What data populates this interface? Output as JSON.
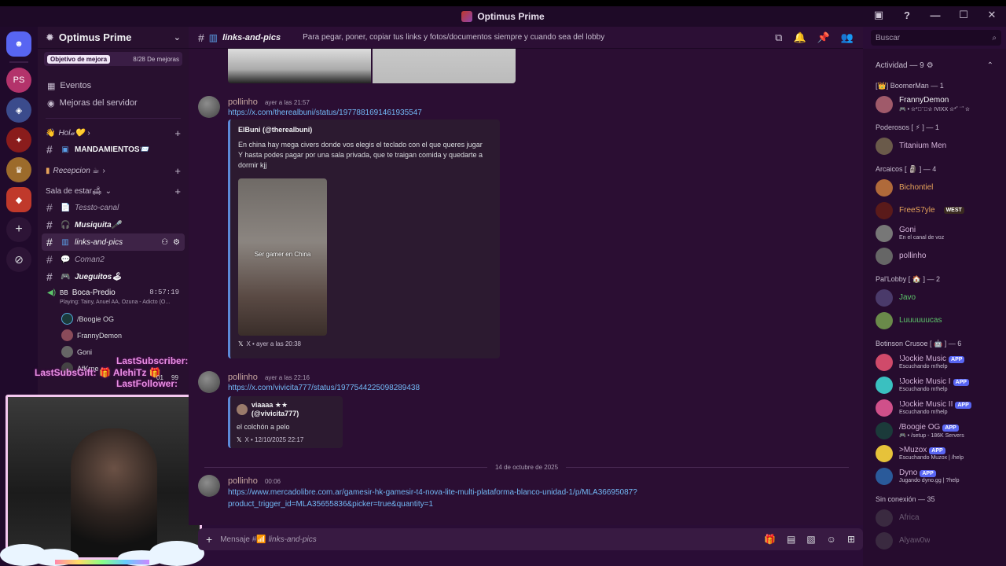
{
  "window": {
    "title": "Optimus Prime",
    "controls": [
      "▣",
      "?",
      "—",
      "☐",
      "✕"
    ]
  },
  "rail": {
    "servers": [
      "PS"
    ]
  },
  "sidebar": {
    "server_name": "Optimus Prime",
    "boost_goal": "Objetivo de mejora",
    "boost_count": "8/28 De mejoras",
    "links": [
      {
        "icon": "calendar-icon",
        "label": "Eventos"
      },
      {
        "icon": "shield-icon",
        "label": "Mejoras del servidor"
      }
    ],
    "categories": {
      "hola": "Hol𝒶💛",
      "recepcion": "Recepcion ☕",
      "sala": "Sala de estar🛋"
    },
    "channels": {
      "mandamientos": "MANDAMIENTOS📨",
      "testo": "Tessto-canal",
      "musiquita": "Musiquita🎤",
      "links": "links-and-pics",
      "coman2": "Coman2",
      "jueguitos": "Jueguitos🕹"
    },
    "voice": {
      "channel": "Boca-Predio",
      "timer": "8:57:19",
      "bb": "BB",
      "playing": "Playing: Tainy, Anuel AA, Ozuna - Adicto (O...",
      "users": [
        "/Boogie OG",
        "FrannyDemon",
        "Goni",
        "AfKrne"
      ]
    }
  },
  "stream_overlay": {
    "last_subscriber": "LastSubscriber:",
    "last_subs_gift": "LastSubsGift: 🎁 AlehiTz 🎁",
    "last_follower": "LastFollower:",
    "counter_a": "01",
    "counter_b": "99"
  },
  "channel_header": {
    "name": "links-and-pics",
    "topic": "Para pegar, poner, copiar tus links y fotos/documentos siempre y cuando sea del lobby"
  },
  "search": {
    "placeholder": "Buscar"
  },
  "messages": [
    {
      "author": "pollinho",
      "time": "ayer a las 21:57",
      "link": "https://x.com/therealbuni/status/1977881691461935547",
      "embed_author": "ElBuni (@therealbuni)",
      "embed_text": [
        "En china hay mega civers donde vos elegis el teclado con el que queres jugar",
        "Y hasta podes pagar por una sala privada, que te traigan comida y quedarte a",
        "dormir kjj"
      ],
      "image_caption": "Ser gamer en China",
      "embed_footer": "X • ayer a las 20:38"
    },
    {
      "author": "pollinho",
      "time": "ayer a las 22:16",
      "link": "https://x.com/vivicita777/status/1977544225098289438",
      "embed_author": "viaaaa ★★ (@vivicita777)",
      "embed_text": [
        "el colchón a pelo"
      ],
      "embed_footer": "X • 12/10/2025 22:17"
    },
    {
      "author": "pollinho",
      "time": "00:06",
      "link_line1": "https://www.mercadolibre.com.ar/gamesir-hk-gamesir-t4-nova-lite-multi-plataforma-blanco-unidad-1/p/MLA36695087?",
      "link_line2": "product_trigger_id=MLA35655836&picker=true&quantity=1"
    }
  ],
  "date_separator": "14 de octubre de 2025",
  "composer": {
    "placeholder_prefix": "Mensaje #📶",
    "placeholder_channel": "links-and-pics"
  },
  "members": {
    "activity_header": "Actividad — 9",
    "groups": [
      {
        "title": "[👑] BoomerMan — 1",
        "members": [
          {
            "name": "FrannyDemon",
            "sub": "🎮 • ✫*ﾟ¨ﾟ✫ IVIXX ✫*ﾟ¨ﾟ✫",
            "color": "#f2f3f5"
          }
        ]
      },
      {
        "title": "Poderosos [ ⚡ ] — 1",
        "members": [
          {
            "name": "Titanium Men",
            "sub": "",
            "color": "#c7a6a0"
          }
        ]
      },
      {
        "title": "Arcaicos [ 🗿 ] — 4",
        "members": [
          {
            "name": "Bichontiel",
            "sub": "",
            "color": "#e6a35a"
          },
          {
            "name": "FreeS7yle",
            "sub": "",
            "color": "#e6a35a",
            "tag": "WEST"
          },
          {
            "name": "Goni",
            "sub": "En el canal de voz",
            "color": "#c7a6a0"
          },
          {
            "name": "pollinho",
            "sub": "",
            "color": "#c7a6a0"
          }
        ]
      },
      {
        "title": "Pal'Lobby [ 🏠 ] — 2",
        "members": [
          {
            "name": "Javo",
            "sub": "",
            "color": "#5cc46a"
          },
          {
            "name": "Luuuuuucas",
            "sub": "",
            "color": "#5cc46a"
          }
        ]
      },
      {
        "title": "Botinson Crusoe [ 🤖 ] — 6",
        "members": [
          {
            "name": "!Jockie Music",
            "sub": "Escuchando m!help",
            "color": "#c7a6a0",
            "app": "APP"
          },
          {
            "name": "!Jockie Music I",
            "sub": "Escuchando m!help",
            "color": "#c7a6a0",
            "app": "APP"
          },
          {
            "name": "!Jockie Music II",
            "sub": "Escuchando m!help",
            "color": "#c7a6a0",
            "app": "APP"
          },
          {
            "name": "/Boogie OG",
            "sub": "🎮 • /setup - 186K Servers",
            "color": "#c7a6a0",
            "app": "APP"
          },
          {
            "name": ">Muzox",
            "sub": "Escuchando Muzox | /help",
            "color": "#c7a6a0",
            "app": "APP"
          },
          {
            "name": "Dyno",
            "sub": "Jugando dyno.gg | ?help",
            "color": "#c7a6a0",
            "app": "APP"
          }
        ]
      }
    ],
    "offline_header": "Sin conexión — 35",
    "offline": [
      "Africa",
      "Alyaw0w"
    ]
  }
}
